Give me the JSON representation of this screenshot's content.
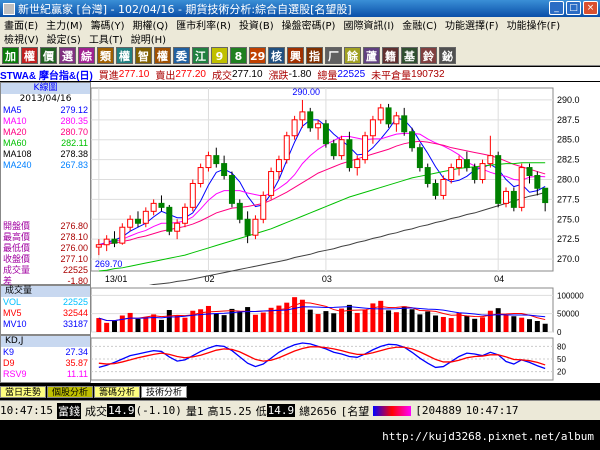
{
  "window": {
    "title": "新世紀贏家 [台灣] - 102/04/16 - 期貨技術分析:綜合自選股[名望股]"
  },
  "menu": {
    "row1": [
      "畫面(E)",
      "主力(M)",
      "籌碼(Y)",
      "期權(Q)",
      "匯市利率(R)",
      "投資(B)",
      "操盤密碼(P)",
      "國際資訊(I)",
      "金融(C)",
      "功能選擇(F)",
      "功能操作(F)"
    ],
    "row2": [
      "檢視(V)",
      "設定(S)",
      "工具(T)",
      "說明(H)"
    ]
  },
  "toolbar": {
    "buttons": [
      {
        "label": "加",
        "color": "#0a7a0a"
      },
      {
        "label": "權",
        "color": "#c02020"
      },
      {
        "label": "價",
        "color": "#206020"
      },
      {
        "label": "選",
        "color": "#803080"
      },
      {
        "label": "綜",
        "color": "#a02090"
      },
      {
        "label": "類",
        "color": "#a06000"
      },
      {
        "label": "權",
        "color": "#208080"
      },
      {
        "label": "智",
        "color": "#806000"
      },
      {
        "label": "權",
        "color": "#a05000"
      },
      {
        "label": "委",
        "color": "#2060a0"
      },
      {
        "label": "江",
        "color": "#208040"
      },
      {
        "label": "9",
        "color": "#c0c000"
      },
      {
        "label": "8",
        "color": "#208020"
      },
      {
        "label": "29",
        "color": "#c04000"
      },
      {
        "label": "核",
        "color": "#205080"
      },
      {
        "label": "興",
        "color": "#a03000"
      },
      {
        "label": "指",
        "color": "#803000"
      },
      {
        "label": "厂",
        "color": "#606060"
      },
      {
        "label": "餘",
        "color": "#a0a020"
      },
      {
        "label": "蘆",
        "color": "#604080"
      },
      {
        "label": "籍",
        "color": "#603030"
      },
      {
        "label": "基",
        "color": "#305030"
      },
      {
        "label": "鈴",
        "color": "#804040"
      },
      {
        "label": "鉍",
        "color": "#505050"
      }
    ]
  },
  "quote": {
    "symbol": "STWA& 摩台指&(日)",
    "bid_label": "買進",
    "bid": "277.10",
    "ask_label": "賣出",
    "ask": "277.20",
    "last_label": "成交",
    "last": "277.10",
    "chg_label": "漲跌",
    "chg": "-1.80",
    "vol_label": "總量",
    "vol": "22525",
    "oi_label": "未平倉量",
    "oi": "190732"
  },
  "left": {
    "head": "K線圖",
    "date": "2013/04/16",
    "ma": [
      {
        "name": "MA5",
        "value": "279.12",
        "color": "#0000ff"
      },
      {
        "name": "MA10",
        "value": "280.35",
        "color": "#ff00ff"
      },
      {
        "name": "MA20",
        "value": "280.70",
        "color": "#ff0080"
      },
      {
        "name": "MA60",
        "value": "282.11",
        "color": "#00c000"
      },
      {
        "name": "MA108",
        "value": "278.38",
        "color": "#000000"
      },
      {
        "name": "MA240",
        "value": "267.83",
        "color": "#0080ff"
      }
    ],
    "ohlc": [
      {
        "name": "開盤價",
        "value": "276.80"
      },
      {
        "name": "最高價",
        "value": "278.10"
      },
      {
        "name": "最低價",
        "value": "276.00"
      },
      {
        "name": "收盤價",
        "value": "277.10"
      },
      {
        "name": "成交量",
        "value": "22525"
      },
      {
        "name": "差",
        "value": "-1.80"
      }
    ]
  },
  "vol": {
    "head": "成交量",
    "rows": [
      {
        "name": "VOL",
        "value": "22525",
        "color": "#00c0ff"
      },
      {
        "name": "MV5",
        "value": "32544",
        "color": "#ff0000"
      },
      {
        "name": "MV10",
        "value": "33187",
        "color": "#0000ff"
      }
    ],
    "ticks": [
      "100000",
      "50000",
      "0"
    ]
  },
  "kd": {
    "head": "KD,J",
    "rows": [
      {
        "name": "K9",
        "value": "27.34",
        "color": "#0000ff"
      },
      {
        "name": "D9",
        "value": "35.87",
        "color": "#ff0000"
      },
      {
        "name": "RSV9",
        "value": "11.11",
        "color": "#ff00ff"
      }
    ],
    "ticks": [
      "80",
      "50",
      "20"
    ]
  },
  "tabs": [
    "當日走勢",
    "個股分析",
    "籌碼分析",
    "技術分析"
  ],
  "status": {
    "time": "10:47:15",
    "name": "富錢",
    "trade": "成交",
    "price": "14.9",
    "chg": "(-1.10)",
    "qty": "量1",
    "high": "高15.25",
    "low": "低",
    "low_v": "14.9",
    "total": "總2656",
    "tag": "[名望",
    "num": "[204889",
    "clock": "10:47:17"
  },
  "footer": {
    "url": "http://kujd3268.pixnet.net/album"
  },
  "chart_data": [
    {
      "type": "candlestick",
      "title": "",
      "yticks": [
        "290.0",
        "287.5",
        "285.0",
        "282.5",
        "280.0",
        "277.5",
        "275.0",
        "272.5",
        "270.0"
      ],
      "ylim": [
        268.5,
        291.5
      ],
      "xticks": [
        "13/01",
        "02",
        "03",
        "04"
      ],
      "annotations": [
        "290.00",
        "269.70"
      ],
      "candles": [
        [
          271.5,
          272.5,
          270.5,
          271.8
        ],
        [
          271.8,
          273.0,
          271.0,
          272.5
        ],
        [
          272.5,
          273.5,
          271.5,
          272.0
        ],
        [
          272.0,
          274.5,
          271.8,
          274.0
        ],
        [
          274.0,
          275.5,
          273.5,
          275.0
        ],
        [
          275.0,
          276.0,
          274.0,
          274.5
        ],
        [
          274.5,
          276.5,
          274.0,
          276.0
        ],
        [
          276.0,
          277.5,
          275.5,
          277.0
        ],
        [
          277.0,
          278.0,
          276.0,
          276.5
        ],
        [
          276.5,
          276.8,
          273.0,
          273.5
        ],
        [
          273.5,
          275.0,
          272.5,
          274.5
        ],
        [
          274.5,
          277.0,
          274.0,
          276.5
        ],
        [
          276.5,
          280.0,
          276.0,
          279.5
        ],
        [
          279.5,
          282.0,
          279.0,
          281.5
        ],
        [
          281.5,
          283.5,
          281.0,
          283.0
        ],
        [
          283.0,
          284.0,
          281.5,
          282.0
        ],
        [
          282.0,
          283.0,
          280.0,
          280.5
        ],
        [
          280.5,
          281.0,
          276.5,
          277.0
        ],
        [
          277.0,
          277.5,
          274.5,
          275.0
        ],
        [
          275.0,
          276.0,
          272.0,
          273.0
        ],
        [
          273.0,
          275.5,
          272.5,
          275.0
        ],
        [
          275.0,
          278.5,
          274.5,
          278.0
        ],
        [
          278.0,
          281.5,
          277.5,
          281.0
        ],
        [
          281.0,
          283.0,
          280.0,
          282.5
        ],
        [
          282.5,
          286.0,
          282.0,
          285.5
        ],
        [
          285.5,
          288.0,
          285.0,
          287.5
        ],
        [
          287.5,
          290.0,
          286.5,
          288.5
        ],
        [
          288.5,
          289.0,
          286.0,
          286.5
        ],
        [
          286.5,
          287.5,
          285.0,
          287.0
        ],
        [
          287.0,
          287.5,
          284.0,
          284.5
        ],
        [
          284.5,
          285.0,
          282.5,
          283.0
        ],
        [
          283.0,
          285.5,
          282.5,
          285.0
        ],
        [
          285.0,
          286.0,
          281.0,
          281.5
        ],
        [
          281.5,
          283.0,
          280.5,
          282.5
        ],
        [
          282.5,
          286.0,
          282.0,
          285.5
        ],
        [
          285.5,
          288.0,
          284.5,
          287.5
        ],
        [
          287.5,
          289.5,
          287.0,
          289.0
        ],
        [
          289.0,
          289.5,
          286.5,
          287.0
        ],
        [
          287.0,
          288.5,
          286.0,
          288.0
        ],
        [
          288.0,
          289.0,
          285.5,
          286.0
        ],
        [
          286.0,
          286.5,
          283.5,
          284.0
        ],
        [
          284.0,
          284.5,
          281.0,
          281.5
        ],
        [
          281.5,
          282.0,
          279.0,
          279.5
        ],
        [
          279.5,
          280.0,
          277.5,
          278.0
        ],
        [
          278.0,
          280.5,
          277.5,
          280.0
        ],
        [
          280.0,
          282.0,
          279.5,
          281.5
        ],
        [
          281.5,
          283.0,
          280.5,
          282.5
        ],
        [
          282.5,
          283.5,
          281.0,
          281.5
        ],
        [
          281.5,
          282.0,
          279.5,
          280.0
        ],
        [
          280.0,
          282.5,
          279.5,
          282.0
        ],
        [
          282.0,
          285.5,
          281.5,
          283.0
        ],
        [
          283.0,
          283.5,
          276.5,
          277.0
        ],
        [
          277.0,
          279.0,
          276.5,
          278.5
        ],
        [
          278.5,
          279.0,
          276.0,
          276.5
        ],
        [
          276.5,
          282.0,
          276.0,
          281.5
        ],
        [
          281.5,
          282.0,
          279.5,
          280.5
        ],
        [
          280.5,
          281.0,
          278.0,
          278.9
        ],
        [
          278.9,
          278.9,
          276.0,
          277.1
        ]
      ],
      "ma": [
        {
          "name": "MA5",
          "color": "#0000ff",
          "values": [
            271.8,
            272.1,
            272.4,
            272.8,
            273.5,
            274.0,
            274.5,
            275.3,
            276.0,
            275.6,
            275.2,
            275.2,
            275.8,
            277.3,
            279.3,
            280.9,
            281.3,
            280.8,
            279.7,
            277.9,
            276.6,
            276.8,
            278.2,
            280.0,
            282.4,
            284.7,
            286.7,
            287.5,
            287.5,
            286.7,
            285.7,
            284.9,
            284.1,
            283.1,
            283.2,
            284.0,
            285.1,
            286.3,
            287.7,
            287.5,
            286.4,
            284.8,
            283.3,
            281.6,
            280.2,
            279.7,
            279.9,
            280.4,
            281.2,
            281.5,
            281.9,
            281.3,
            280.0,
            279.1,
            279.4,
            278.4,
            278.6,
            279.12
          ]
        },
        {
          "name": "MA10",
          "color": "#ff00ff",
          "values": [
            271.8,
            272.0,
            272.2,
            272.5,
            272.9,
            273.3,
            273.6,
            274.1,
            274.5,
            274.5,
            274.6,
            274.8,
            275.3,
            276.3,
            277.4,
            278.2,
            278.6,
            278.6,
            278.6,
            278.3,
            278.1,
            277.9,
            278.3,
            278.9,
            279.6,
            280.6,
            282.0,
            283.0,
            283.8,
            284.4,
            284.9,
            285.4,
            285.4,
            285.2,
            285.0,
            285.1,
            285.1,
            285.4,
            285.7,
            285.8,
            285.8,
            285.7,
            285.1,
            284.6,
            284.2,
            283.7,
            283.1,
            282.2,
            281.7,
            281.3,
            280.9,
            280.6,
            280.4,
            280.0,
            279.9,
            280.3,
            280.4,
            280.35
          ]
        },
        {
          "name": "MA20",
          "color": "#ff0080",
          "values": [
            271.8,
            271.9,
            272.0,
            272.2,
            272.4,
            272.7,
            272.9,
            273.2,
            273.5,
            273.7,
            273.9,
            274.1,
            274.4,
            274.8,
            275.3,
            275.8,
            276.1,
            276.4,
            276.5,
            276.6,
            276.8,
            277.0,
            277.4,
            277.9,
            278.4,
            279.0,
            279.6,
            280.2,
            280.8,
            281.2,
            281.6,
            282.0,
            282.3,
            282.6,
            282.9,
            283.2,
            283.5,
            283.8,
            284.2,
            284.5,
            284.7,
            284.8,
            284.7,
            284.5,
            284.3,
            284.0,
            283.8,
            283.6,
            283.4,
            283.2,
            283.0,
            282.7,
            282.3,
            281.9,
            281.6,
            281.3,
            281.0,
            280.7
          ]
        },
        {
          "name": "MA60",
          "color": "#00c000",
          "values": [
            268.5,
            268.6,
            268.8,
            268.9,
            269.1,
            269.3,
            269.5,
            269.7,
            269.9,
            270.1,
            270.3,
            270.5,
            270.8,
            271.1,
            271.4,
            271.7,
            272.0,
            272.3,
            272.6,
            272.9,
            273.2,
            273.5,
            273.8,
            274.2,
            274.6,
            275.0,
            275.4,
            275.8,
            276.2,
            276.6,
            277.0,
            277.4,
            277.8,
            278.1,
            278.4,
            278.7,
            279.0,
            279.3,
            279.6,
            279.9,
            280.2,
            280.4,
            280.6,
            280.8,
            281.0,
            281.2,
            281.4,
            281.5,
            281.6,
            281.7,
            281.8,
            281.9,
            282.0,
            282.0,
            282.1,
            282.1,
            282.1,
            282.11
          ]
        },
        {
          "name": "MA108",
          "color": "#404040",
          "values": [
            266.0,
            266.1,
            266.2,
            266.3,
            266.4,
            266.5,
            266.6,
            266.8,
            266.9,
            267.0,
            267.2,
            267.3,
            267.5,
            267.7,
            267.9,
            268.1,
            268.3,
            268.5,
            268.7,
            268.9,
            269.1,
            269.3,
            269.5,
            269.7,
            269.9,
            270.2,
            270.4,
            270.6,
            270.9,
            271.1,
            271.3,
            271.6,
            271.8,
            272.1,
            272.3,
            272.6,
            272.8,
            273.1,
            273.3,
            273.6,
            273.8,
            274.1,
            274.3,
            274.6,
            274.8,
            275.1,
            275.3,
            275.6,
            275.8,
            276.1,
            276.4,
            276.7,
            277.0,
            277.3,
            277.6,
            277.9,
            278.1,
            278.38
          ]
        }
      ]
    },
    {
      "type": "bar",
      "title": "成交量",
      "ylim": [
        0,
        120000
      ],
      "values": [
        38000,
        25000,
        30000,
        45000,
        52000,
        36000,
        41000,
        48000,
        33000,
        60000,
        44000,
        39000,
        58000,
        62000,
        71000,
        50000,
        46000,
        63000,
        55000,
        68000,
        47000,
        53000,
        66000,
        72000,
        80000,
        95000,
        88000,
        61000,
        49000,
        57000,
        51000,
        64000,
        74000,
        52000,
        60000,
        78000,
        85000,
        59000,
        54000,
        70000,
        62000,
        48000,
        56000,
        45000,
        41000,
        38000,
        52000,
        44000,
        36000,
        40000,
        58000,
        65000,
        47000,
        43000,
        39000,
        35000,
        30000,
        22525
      ],
      "ma": [
        {
          "name": "MV5",
          "color": "#ff0000"
        },
        {
          "name": "MV10",
          "color": "#0000ff"
        }
      ]
    },
    {
      "type": "line",
      "title": "KD,J",
      "ylim": [
        0,
        100
      ],
      "series": [
        {
          "name": "K9",
          "color": "#0000ff",
          "values": [
            30,
            35,
            42,
            50,
            58,
            62,
            66,
            70,
            68,
            55,
            45,
            48,
            58,
            68,
            76,
            82,
            80,
            70,
            55,
            40,
            32,
            38,
            52,
            66,
            76,
            84,
            88,
            86,
            80,
            74,
            66,
            62,
            56,
            54,
            62,
            72,
            80,
            85,
            84,
            78,
            66,
            52,
            40,
            30,
            32,
            44,
            56,
            64,
            62,
            58,
            66,
            60,
            44,
            38,
            48,
            42,
            34,
            27.34
          ]
        },
        {
          "name": "D9",
          "color": "#ff0000",
          "values": [
            40,
            38,
            39,
            43,
            48,
            53,
            57,
            61,
            64,
            61,
            56,
            53,
            55,
            59,
            65,
            71,
            74,
            73,
            67,
            58,
            49,
            45,
            47,
            53,
            61,
            69,
            75,
            79,
            79,
            77,
            74,
            70,
            65,
            61,
            61,
            65,
            70,
            75,
            78,
            78,
            74,
            67,
            58,
            49,
            43,
            43,
            47,
            53,
            56,
            57,
            60,
            60,
            55,
            49,
            48,
            46,
            42,
            35.87
          ]
        }
      ]
    }
  ]
}
